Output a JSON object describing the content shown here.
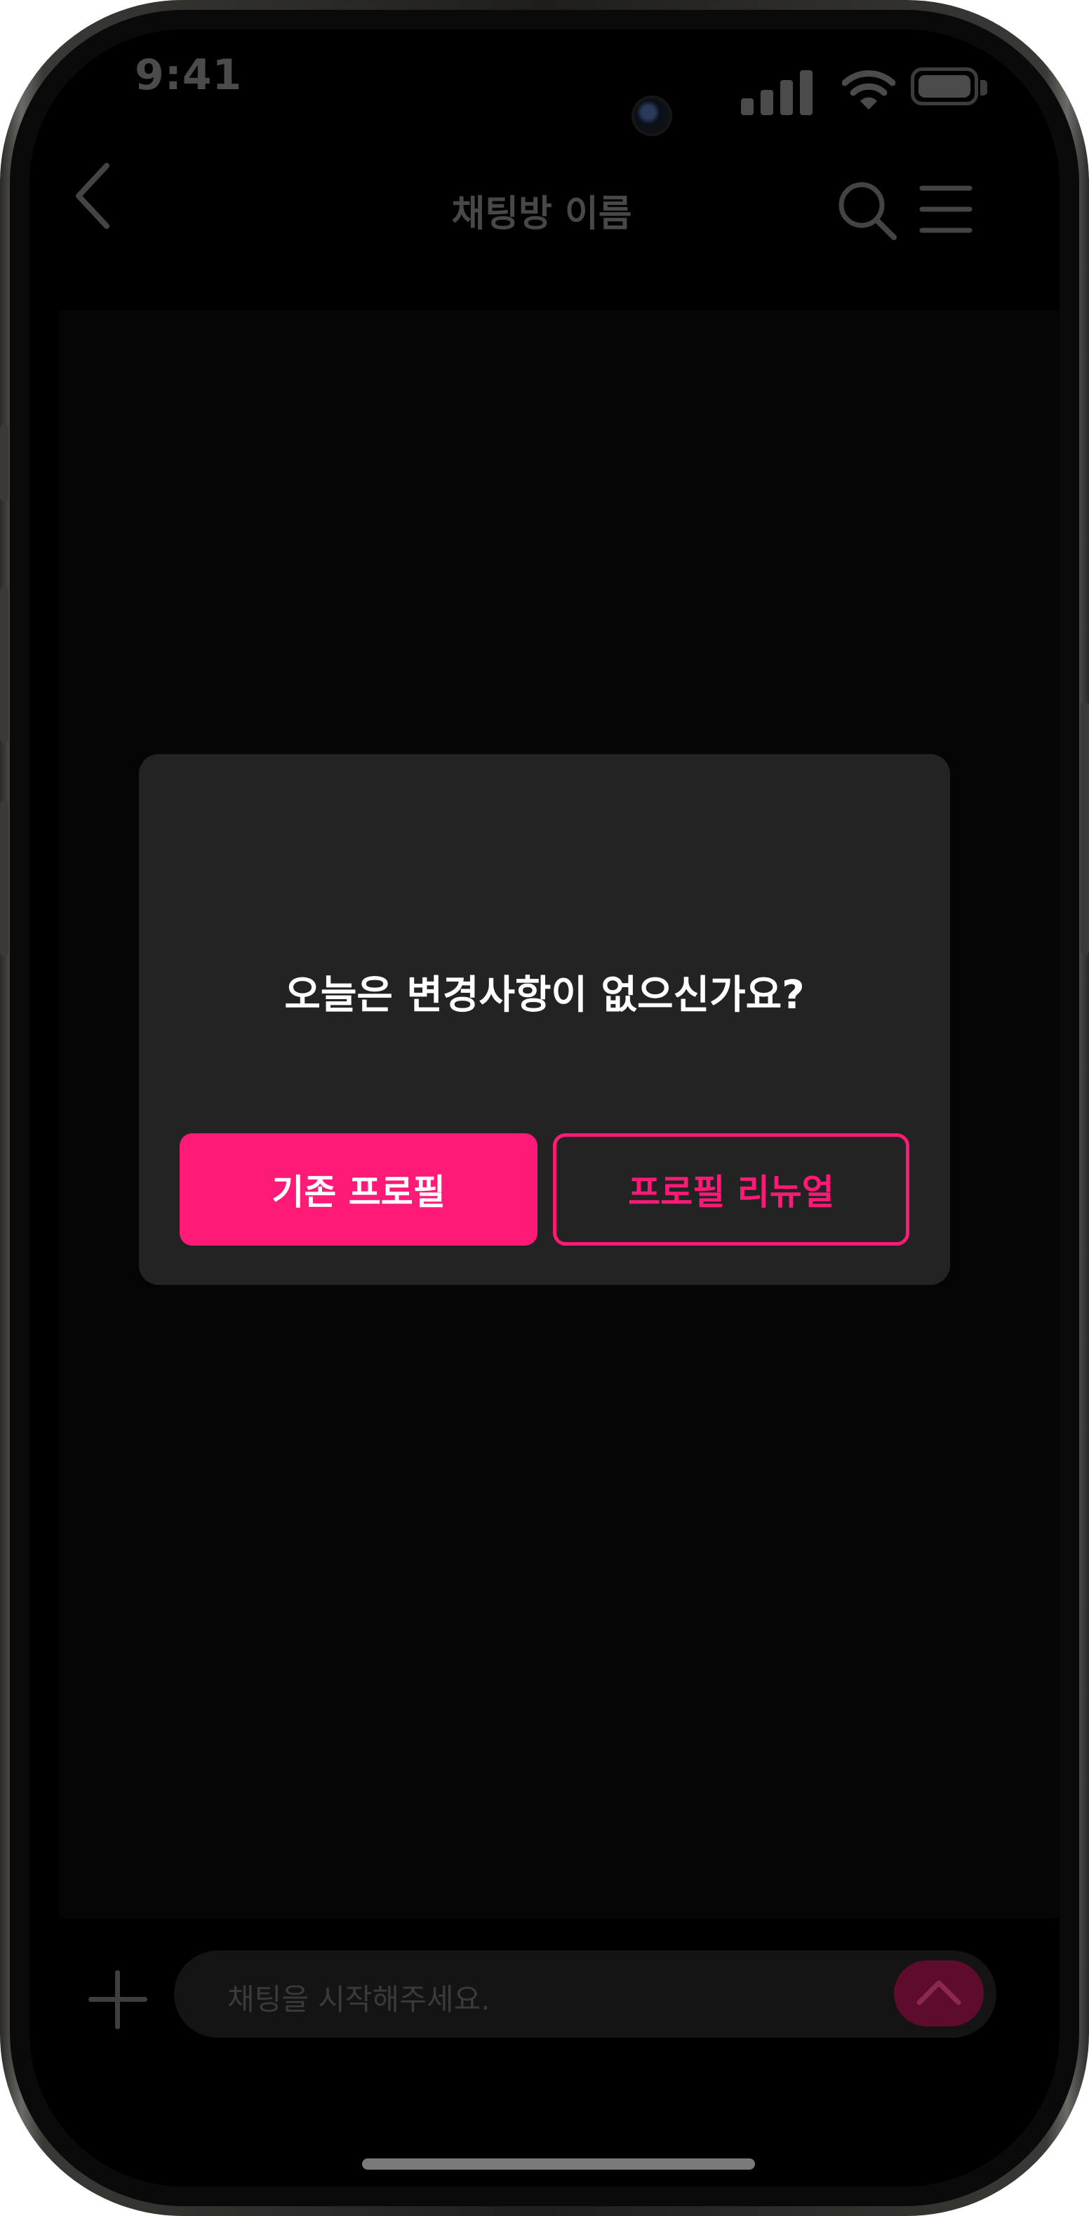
{
  "status_bar": {
    "time": "9:41"
  },
  "nav": {
    "title": "채팅방 이름"
  },
  "modal": {
    "title": "오늘은 변경사항이 없으신가요?",
    "primary_button": "기존 프로필",
    "secondary_button": "프로필 리뉴얼"
  },
  "input": {
    "placeholder": "채팅을 시작해주세요."
  },
  "colors": {
    "accent": "#ff1a78",
    "modal_bg": "#232323",
    "screen_bg": "#000000"
  },
  "icons": [
    "back-chevron-icon",
    "search-icon",
    "hamburger-menu-icon",
    "plus-icon",
    "send-arrow-up-icon",
    "signal-icon",
    "wifi-icon",
    "battery-icon"
  ]
}
